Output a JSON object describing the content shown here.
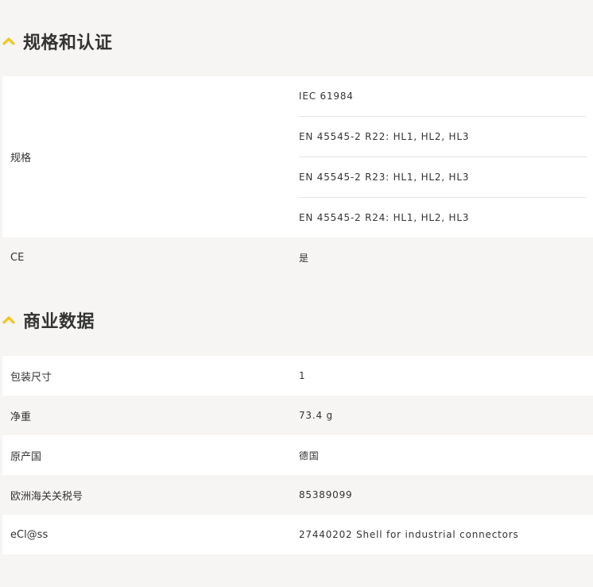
{
  "sections": [
    {
      "title": "规格和认证",
      "specs": {
        "label": "规格",
        "values": [
          "IEC 61984",
          "EN 45545-2 R22: HL1, HL2, HL3",
          "EN 45545-2 R23: HL1, HL2, HL3",
          "EN 45545-2 R24: HL1, HL2, HL3"
        ]
      },
      "ce": {
        "label": "CE",
        "value": "是"
      }
    },
    {
      "title": "商业数据",
      "rows": [
        {
          "label": "包装尺寸",
          "value": "1"
        },
        {
          "label": "净重",
          "value": "73.4 g"
        },
        {
          "label": "原产国",
          "value": "德国"
        },
        {
          "label": "欧洲海关关税号",
          "value": "85389099"
        },
        {
          "label": "eCl@ss",
          "value": "27440202 Shell for industrial connectors"
        }
      ]
    }
  ],
  "colors": {
    "accent": "#f5c518",
    "text": "#333333",
    "row_white": "#ffffff",
    "row_gray": "#f6f5f3",
    "divider": "#e3e3e3"
  },
  "icons": {
    "section_toggle": "chevron-up-icon"
  }
}
